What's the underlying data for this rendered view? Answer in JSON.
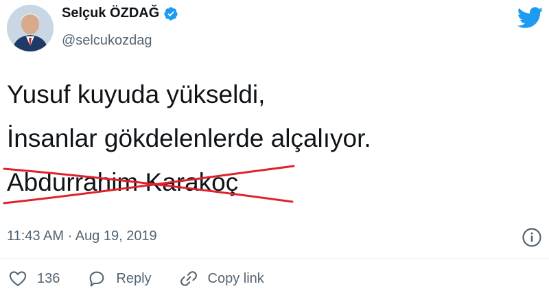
{
  "author": {
    "display_name": "Selçuk ÖZDAĞ",
    "handle": "@selcukozdag"
  },
  "tweet": {
    "lines": [
      "Yusuf kuyuda yükseldi,",
      "İnsanlar gökdelenlerde alçalıyor.",
      "Abdurrahim Karakoç"
    ],
    "timestamp": "11:43 AM · Aug 19, 2019"
  },
  "actions": {
    "like_count": "136",
    "reply_label": "Reply",
    "copy_link_label": "Copy link"
  },
  "icons": {
    "brand": "twitter-bird-icon",
    "verified": "verified-badge-icon",
    "info": "info-icon",
    "like": "heart-icon",
    "reply": "reply-bubble-icon",
    "copy": "link-icon"
  },
  "colors": {
    "twitter_blue": "#1d9bf0",
    "cross_red": "#e0202a",
    "secondary_text": "#536471"
  }
}
